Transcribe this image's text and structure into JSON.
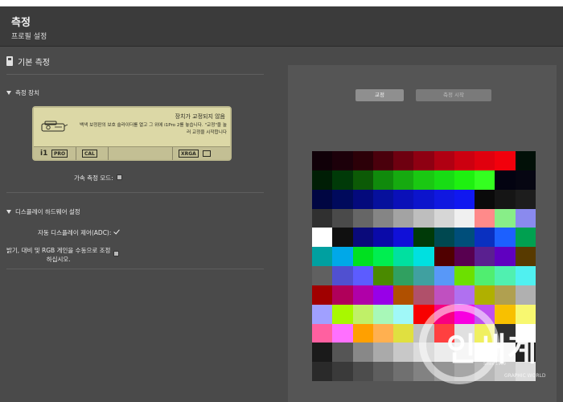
{
  "header": {
    "title": "측정",
    "subtitle": "프로필 설정"
  },
  "basic": {
    "title": "기본 측정"
  },
  "device_group": {
    "title": "측정 장치",
    "lcd": {
      "title": "장치가 교정되지 않음",
      "message": "백색 보정판의 보호 슬라이더를 열고 그 위에 i1Pro 2를 놓습니다. \"교정\"을 눌러 교정을 시작합니다",
      "brand_i1": "i1",
      "brand_pro": "PRO",
      "cal": "CAL",
      "resolution": "XRGA"
    },
    "fast_mode_label": "가속 측정 모드:"
  },
  "display_group": {
    "title": "디스플레이 하드웨어 설정",
    "adc_label": "자동 디스플레이 제어(ADC):",
    "manual_label_line1": "밝기, 대비 및 RGB 게인을 수동으로 조정",
    "manual_label_line2": "하십시오."
  },
  "buttons": {
    "calibrate": "교정",
    "start": "측정 시작"
  },
  "colors": {
    "patches": [
      "#100008",
      "#1c000a",
      "#2c0008",
      "#4a000c",
      "#6e0010",
      "#8e0012",
      "#b00012",
      "#cc0010",
      "#e0000e",
      "#f2000c",
      "#021008",
      "#001e05",
      "#003a08",
      "#0c5a06",
      "#108a0c",
      "#16aa10",
      "#1ac812",
      "#18dc14",
      "#1ef010",
      "#34ff20",
      "#030311",
      "#060612",
      "#000642",
      "#000a5c",
      "#040a7c",
      "#06109c",
      "#0a10b8",
      "#0c14cc",
      "#1018e0",
      "#1018f0",
      "#0a0a0a",
      "#151515",
      "#1d1d1d",
      "#303030",
      "#4a4a4a",
      "#666666",
      "#858585",
      "#a3a3a3",
      "#bebebe",
      "#d6d6d6",
      "#f0f0f0",
      "#ff8a8a",
      "#88ee88",
      "#8a8aee",
      "#ffffff",
      "#101010",
      "#0a0a7a",
      "#0a0aa8",
      "#1010d8",
      "#003a08",
      "#004850",
      "#004e7a",
      "#0a30c0",
      "#1c60ff",
      "#00a050",
      "#00a0a0",
      "#00a8e8",
      "#00e020",
      "#00ee50",
      "#00e0a0",
      "#00e0e0",
      "#500000",
      "#580050",
      "#5a2090",
      "#6000c0",
      "#583a00",
      "#606060",
      "#5050d0",
      "#5c5cff",
      "#4a8a00",
      "#30a060",
      "#40a0a0",
      "#5898f8",
      "#6ce000",
      "#50ee70",
      "#50f0b0",
      "#50f0f0",
      "#a00000",
      "#b0005a",
      "#b000a8",
      "#9800e8",
      "#b05000",
      "#b0506a",
      "#c050c0",
      "#b070f0",
      "#b0b000",
      "#b0a050",
      "#b0b0b0",
      "#a0a0ff",
      "#a8f800",
      "#c0f068",
      "#a8f8b8",
      "#a0f8f8",
      "#f80000",
      "#f80080",
      "#f800e0",
      "#c050f0",
      "#f8c000",
      "#f8f870",
      "#ff60a0",
      "#ff70ff",
      "#ffa000",
      "#ffb050",
      "#e0e040",
      "#c0c0c0",
      "#ff4040",
      "#e0e0e0",
      "#f0f060",
      "#303030",
      "#ffffff",
      "#1a1a1a",
      "#555555",
      "#888888",
      "#aaaaaa",
      "#c8c8c8",
      "#dcdcdc",
      "#ececec",
      "#f6f6f6",
      "#ffffff",
      "#f8f8f8",
      "#222222",
      "#2a2a2a",
      "#3a3a3a",
      "#4c4c4c",
      "#5e5e5e",
      "#707070",
      "#828282",
      "#949494",
      "#a6a6a6",
      "#b8b8b8",
      "#cacaca",
      "#dcdcdc"
    ]
  },
  "watermark": {
    "main": "인새계",
    "sub": "GRAPHIC WORLD",
    "tag": "Since 1969"
  }
}
